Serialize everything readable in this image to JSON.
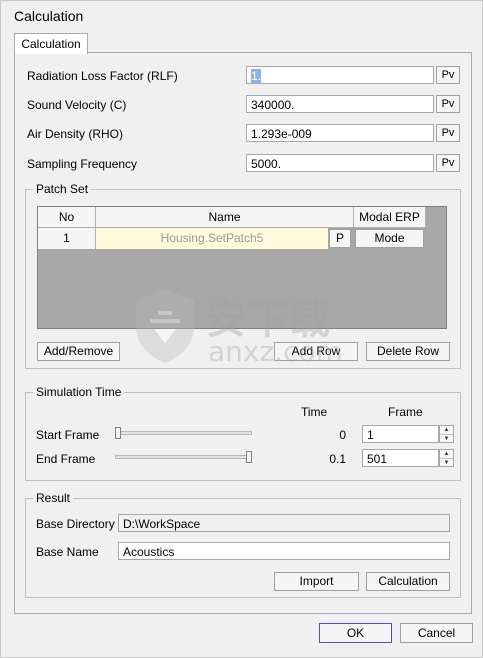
{
  "window": {
    "title": "Calculation"
  },
  "tab": {
    "label": "Calculation"
  },
  "params": [
    {
      "label": "Radiation Loss Factor (RLF)",
      "value": "1.",
      "pv": "Pv"
    },
    {
      "label": "Sound Velocity (C)",
      "value": "340000.",
      "pv": "Pv"
    },
    {
      "label": "Air Density (RHO)",
      "value": "1.293e-009",
      "pv": "Pv"
    },
    {
      "label": "Sampling Frequency",
      "value": "5000.",
      "pv": "Pv"
    }
  ],
  "patch_set": {
    "title": "Patch Set",
    "columns": [
      "No",
      "Name",
      "Modal ERP"
    ],
    "rows": [
      {
        "no": "1",
        "name": "Housing.SetPatch5",
        "p_button": "P",
        "mode_button": "Mode"
      }
    ],
    "buttons": {
      "add_remove": "Add/Remove",
      "add_row": "Add Row",
      "delete_row": "Delete Row"
    }
  },
  "simulation_time": {
    "title": "Simulation Time",
    "col_time": "Time",
    "col_frame": "Frame",
    "start": {
      "label": "Start Frame",
      "time": "0",
      "frame": "1",
      "slider_fraction": 0
    },
    "end": {
      "label": "End Frame",
      "time": "0.1",
      "frame": "501",
      "slider_fraction": 1
    }
  },
  "result": {
    "title": "Result",
    "base_directory_label": "Base Directory",
    "base_directory": "D:\\WorkSpace",
    "base_name_label": "Base Name",
    "base_name": "Acoustics",
    "import_label": "Import",
    "calculation_label": "Calculation"
  },
  "dialog": {
    "ok": "OK",
    "cancel": "Cancel"
  },
  "watermark": {
    "cn_text": "安下载",
    "text": "anxz.com"
  },
  "colors": {
    "name_cell_bg": "#fffbdc",
    "grid_bg": "#a8a8a8",
    "ok_border": "#5a4ea8"
  }
}
